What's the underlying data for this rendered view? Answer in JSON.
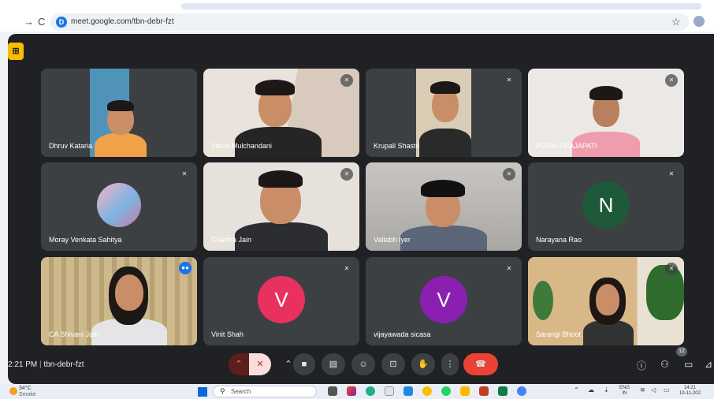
{
  "browser": {
    "url": "meet.google.com/tbn-debr-fzt",
    "site_icon": "D",
    "back_icon": "→",
    "reload_icon": "C"
  },
  "participants": [
    {
      "name": "Dhruv Kataria"
    },
    {
      "name": "Varun Mulchandani"
    },
    {
      "name": "Krupali Shastri"
    },
    {
      "name": "PURVI PRAJAPATI"
    },
    {
      "name": "Moray Venkata Sahitya"
    },
    {
      "name": "Charitra Jain"
    },
    {
      "name": "Vallabh Iyer"
    },
    {
      "name": "Narayana Rao",
      "initial": "N",
      "avatar_color": "#1e5a3a"
    },
    {
      "name": "CA Shivani Jain"
    },
    {
      "name": "Vinit Shah",
      "initial": "V",
      "avatar_color": "#e8315f"
    },
    {
      "name": "vijayawada sicasa",
      "initial": "V",
      "avatar_color": "#8a1fb0"
    },
    {
      "name": "Sarangi Bhoot"
    }
  ],
  "controls": {
    "time": "2:21 PM",
    "separator": "|",
    "meeting_code": "tbn-debr-fzt",
    "people_count": "12"
  },
  "taskbar": {
    "temperature": "34°C",
    "weather": "Smoke",
    "search_placeholder": "Search",
    "language": "ENG",
    "region": "IN",
    "clock_time": "14:21",
    "clock_date": "10-11-202"
  }
}
